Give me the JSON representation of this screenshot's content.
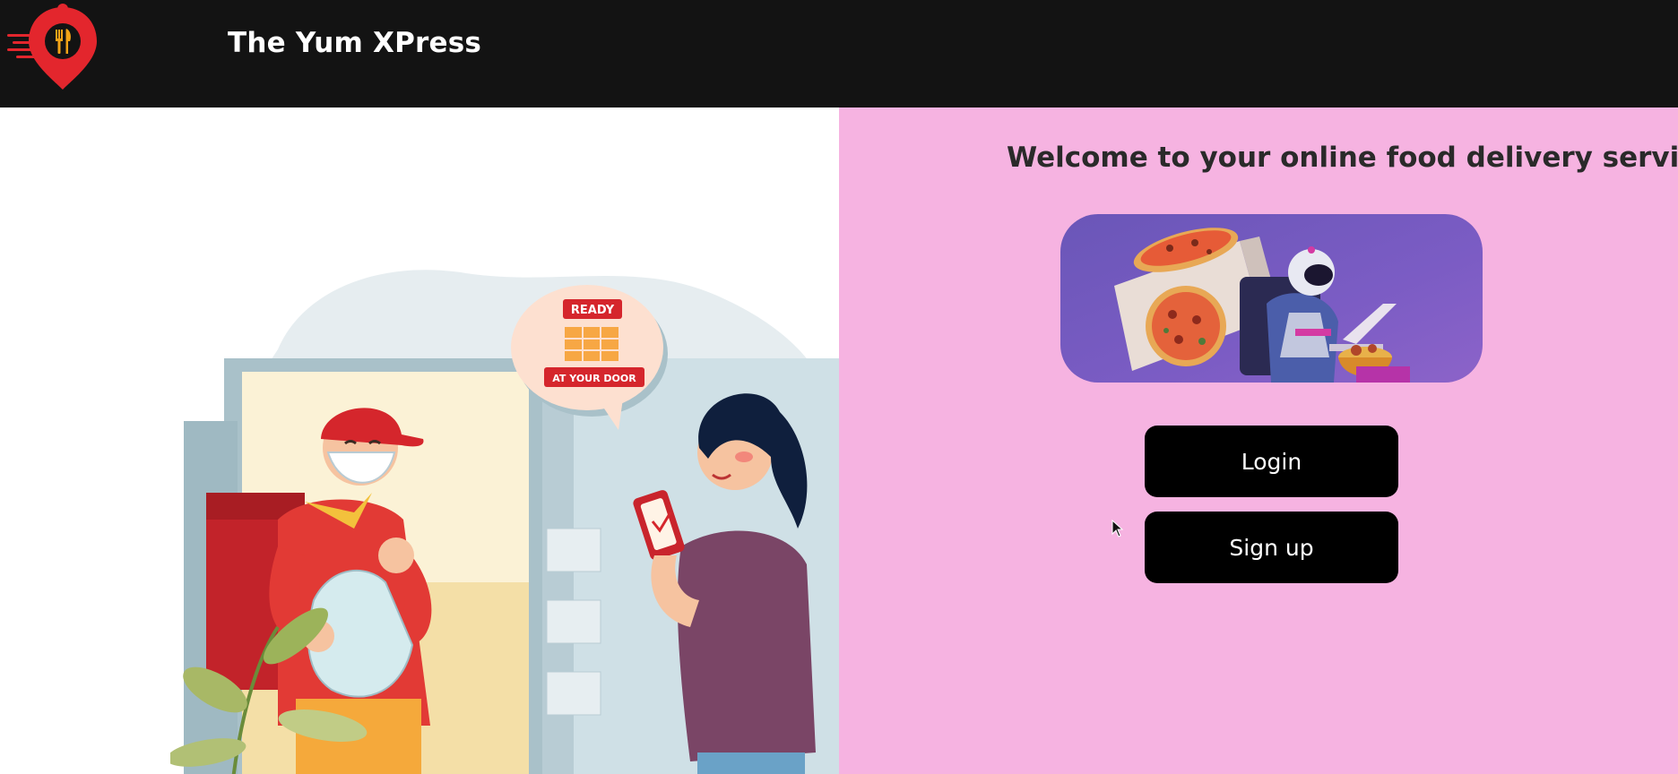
{
  "navbar": {
    "brand": "The Yum XPress",
    "logo_icon": "location-pin-cutlery-icon",
    "background": "#131313",
    "logo_color": "#e3262d"
  },
  "hero": {
    "illustration": "delivery-person-handing-bag-illustration",
    "bubble_top": "READY",
    "bubble_bottom": "AT YOUR DOOR"
  },
  "main": {
    "welcome": "Welcome to your online food delivery service",
    "banner_image": "astronaut-pizza-delivery-banner",
    "panel_color": "#f6b3e1",
    "login_label": "Login",
    "signup_label": "Sign up"
  }
}
